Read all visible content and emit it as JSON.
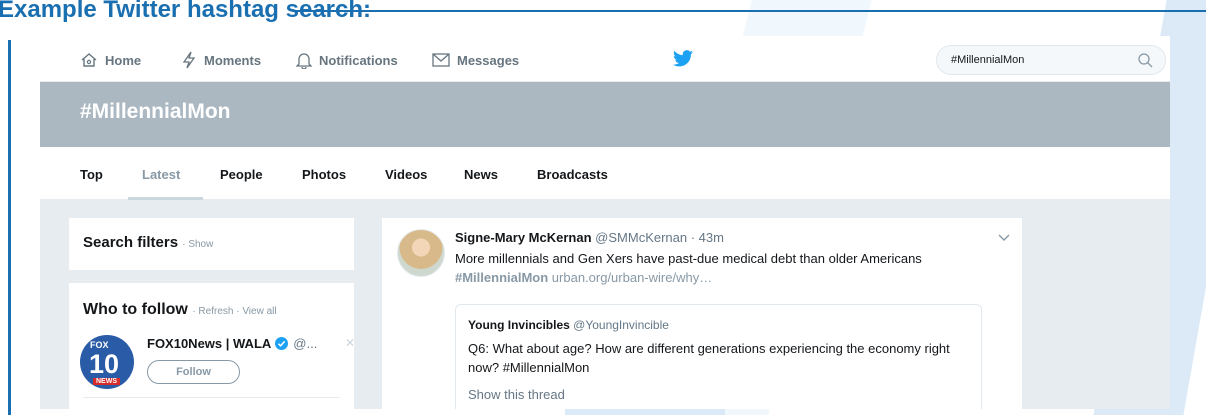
{
  "slide": {
    "title": "Example Twitter hashtag search:"
  },
  "nav": {
    "home": "Home",
    "moments": "Moments",
    "notifications": "Notifications",
    "messages": "Messages",
    "search_value": "#MillennialMon"
  },
  "banner": {
    "title": "#MillennialMon"
  },
  "tabs": [
    "Top",
    "Latest",
    "People",
    "Photos",
    "Videos",
    "News",
    "Broadcasts"
  ],
  "active_tab": "Latest",
  "filters": {
    "title": "Search filters",
    "show": "· Show"
  },
  "who_to_follow": {
    "title": "Who to follow",
    "links": "· Refresh · View all",
    "account": {
      "name": "FOX10News | WALA",
      "handle": "@...",
      "follow_label": "Follow",
      "logo_top": "FOX",
      "logo_num": "10",
      "logo_bottom": "NEWS"
    }
  },
  "tweet": {
    "name": "Signe-Mary McKernan",
    "handle_time": "@SMMcKernan · 43m",
    "text": "More millennials and Gen Xers have past-due medical debt than older Americans",
    "hashtag": "#MillennialMon",
    "link": "urban.org/urban-wire/why…",
    "quote": {
      "name": "Young Invincibles",
      "handle": "@YoungInvincible",
      "text": "Q6: What about age? How are different generations experiencing the economy right now? #MillennialMon",
      "thread_link": "Show this thread"
    }
  },
  "colors": {
    "title_blue": "#1a6fb0",
    "twitter_blue": "#1da1f2",
    "banner_gray": "#abb8c2"
  }
}
